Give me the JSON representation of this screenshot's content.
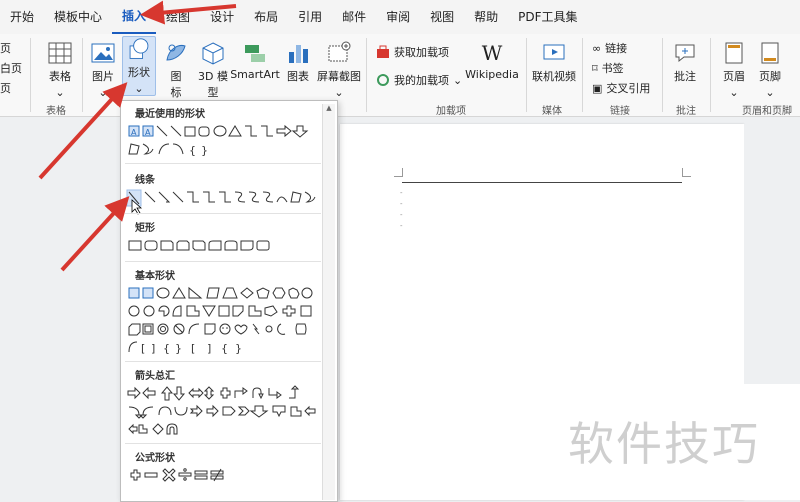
{
  "menubar": {
    "tabs": [
      "开始",
      "模板中心",
      "插入",
      "绘图",
      "设计",
      "布局",
      "引用",
      "邮件",
      "审阅",
      "视图",
      "帮助",
      "PDF工具集"
    ],
    "active_index": 2
  },
  "ribbon": {
    "left_partial": [
      "页",
      "白页",
      "页"
    ],
    "table_label": "表格",
    "picture_label": "图片",
    "shape_label": "形状",
    "icons_label_1": "图",
    "icons_label_2": "标",
    "model3d_label": "3D 模",
    "model3d_label_2": "型",
    "smartart_label": "SmartArt",
    "chart_label": "图表",
    "screenshot_label": "屏幕截图",
    "get_addins": "获取加载项",
    "my_addins": "我的加载项",
    "wikipedia": "Wikipedia",
    "online_video": "联机视频",
    "link": "链接",
    "bookmark": "书签",
    "cross_ref": "交叉引用",
    "comment": "批注",
    "header": "页眉",
    "footer": "页脚",
    "groups": {
      "tables": "表格",
      "addins": "加载项",
      "media": "媒体",
      "links": "链接",
      "comments": "批注",
      "header_footer": "页眉和页脚"
    }
  },
  "shapes_panel": {
    "sections": [
      "最近使用的形状",
      "线条",
      "矩形",
      "基本形状",
      "箭头总汇",
      "公式形状"
    ]
  },
  "watermark": "软件技巧",
  "colors": {
    "accent": "#1a5cbf",
    "arrow": "#d7372f"
  }
}
